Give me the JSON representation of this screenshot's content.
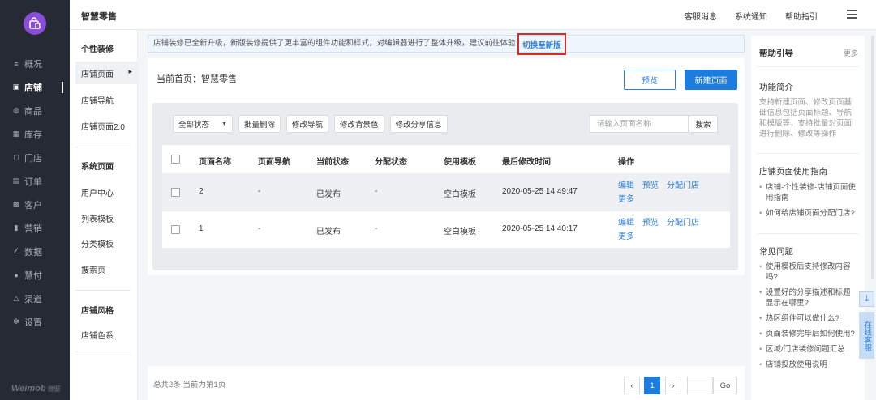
{
  "app": {
    "brand_logo": "bag-icon",
    "name": "智慧零售",
    "brand_footer": "Weimob",
    "brand_footer_sub": "微盟"
  },
  "header": {
    "links": [
      "客服消息",
      "系统通知",
      "帮助指引"
    ],
    "menu_icon": "hamburger-icon"
  },
  "sidebar": {
    "items": [
      {
        "label": "概况",
        "icon": "overview-icon",
        "glyph": "≡"
      },
      {
        "label": "店铺",
        "icon": "store-icon",
        "glyph": "▣",
        "active": true
      },
      {
        "label": "商品",
        "icon": "goods-icon",
        "glyph": "◍"
      },
      {
        "label": "库存",
        "icon": "inventory-icon",
        "glyph": "▦"
      },
      {
        "label": "门店",
        "icon": "shop-icon",
        "glyph": "◻"
      },
      {
        "label": "订单",
        "icon": "order-icon",
        "glyph": "▤"
      },
      {
        "label": "客户",
        "icon": "customer-icon",
        "glyph": "▩"
      },
      {
        "label": "营销",
        "icon": "marketing-icon",
        "glyph": "▮"
      },
      {
        "label": "数据",
        "icon": "data-icon",
        "glyph": "∠"
      },
      {
        "label": "慧付",
        "icon": "pay-icon",
        "glyph": "●"
      },
      {
        "label": "渠道",
        "icon": "channel-icon",
        "glyph": "△"
      },
      {
        "label": "设置",
        "icon": "settings-icon",
        "glyph": "✻"
      }
    ]
  },
  "subnav": {
    "groups": [
      {
        "title": "个性装修",
        "items": [
          "店铺页面",
          "店铺导航",
          "店铺页面2.0"
        ]
      },
      {
        "title": "系统页面",
        "items": [
          "用户中心",
          "列表模板",
          "分类模板",
          "搜索页"
        ]
      },
      {
        "title": "店铺风格",
        "items": [
          "店铺色系"
        ]
      }
    ],
    "active": "店铺页面"
  },
  "notice": {
    "text": "店铺装修已全新升级，新版装修提供了更丰富的组件功能和样式，对编辑器进行了整体升级，建议前往体验",
    "link": "切换至新版"
  },
  "page": {
    "current_home": "当前首页：智慧零售",
    "preview_button": "预览",
    "new_page_button": "新建页面"
  },
  "toolbar": {
    "status_select": "全部状态",
    "buttons": [
      "批量删除",
      "修改导航",
      "修改背景色",
      "修改分享信息"
    ],
    "search_placeholder": "请输入页面名称",
    "search_button": "搜索"
  },
  "table": {
    "columns": [
      "页面名称",
      "页面导航",
      "当前状态",
      "分配状态",
      "使用模板",
      "最后修改时间",
      "操作"
    ],
    "rows": [
      {
        "name": "2",
        "nav": "-",
        "status": "已发布",
        "assign": "-",
        "template": "空白模板",
        "modified": "2020-05-25 14:49:47",
        "ops": [
          "编辑",
          "预览",
          "分配门店",
          "更多"
        ]
      },
      {
        "name": "1",
        "nav": "-",
        "status": "已发布",
        "assign": "-",
        "template": "空白模板",
        "modified": "2020-05-25 14:40:17",
        "ops": [
          "编辑",
          "预览",
          "分配门店",
          "更多"
        ]
      }
    ]
  },
  "pagination": {
    "summary": "总共2条 当前为第1页",
    "prev": "‹",
    "current": "1",
    "next": "›",
    "go": "Go"
  },
  "help": {
    "title": "帮助引导",
    "more": "更多",
    "intro_title": "功能简介",
    "intro_text": "支持新建页面、修改页面基础信息包括页面标题、导航和模版等，支持批量对页面进行删除、修改等操作",
    "guide_title": "店铺页面使用指南",
    "guide_items": [
      "店铺-个性装修-店铺页面使用指南",
      "如何给店铺页面分配门店?"
    ],
    "faq_title": "常见问题",
    "faq_items": [
      "使用模板后支持修改内容吗?",
      "设置好的分享描述和标题显示在哪里?",
      "热区组件可以做什么?",
      "页面装修完毕后如何使用?",
      "区域/门店装修问题汇总",
      "店铺投放使用说明"
    ]
  },
  "floating": {
    "download_icon": "download-icon",
    "service_label": "在线客服"
  }
}
